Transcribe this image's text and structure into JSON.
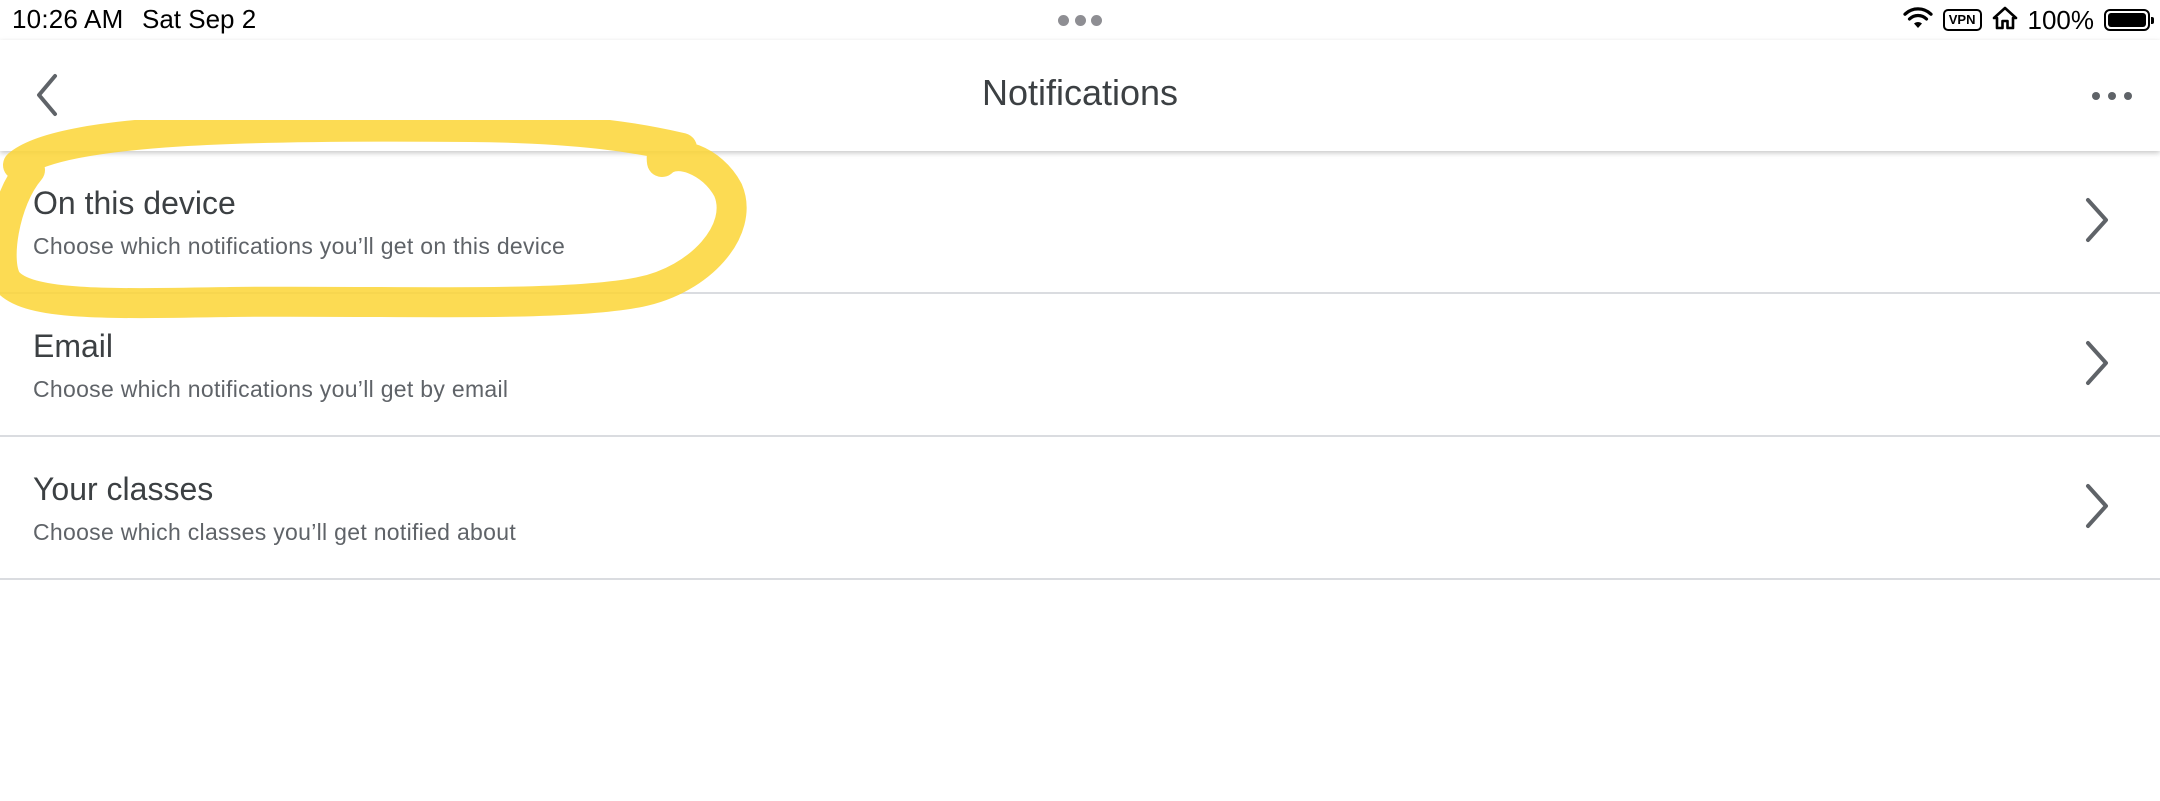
{
  "status_bar": {
    "time": "10:26 AM",
    "date": "Sat Sep 2",
    "vpn_label": "VPN",
    "battery_percent": "100%",
    "battery_level": 1.0,
    "icons": [
      "wifi-icon",
      "vpn-icon",
      "home-icon",
      "battery-icon"
    ]
  },
  "app_bar": {
    "title": "Notifications",
    "back_icon": "chevron-left-icon",
    "more_icon": "more-horizontal-icon"
  },
  "items": [
    {
      "title": "On this device",
      "subtitle": "Choose which notifications you’ll get on this device"
    },
    {
      "title": "Email",
      "subtitle": "Choose which notifications you’ll get by email"
    },
    {
      "title": "Your classes",
      "subtitle": "Choose which classes you’ll get notified about"
    }
  ],
  "colors": {
    "highlight": "#fcd535",
    "text_primary": "#3c4043",
    "text_secondary": "#5f6368",
    "divider": "#dadce0"
  }
}
